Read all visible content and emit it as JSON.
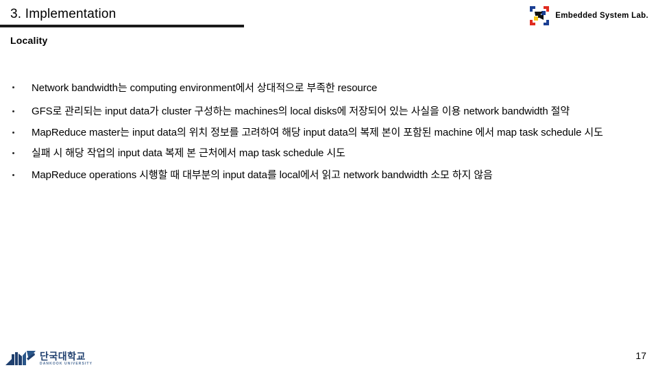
{
  "header": {
    "title": "3. Implementation",
    "lab": {
      "name": "Embedded System Lab.",
      "logo_icon": "puzzle-pinwheel-logo-icon",
      "colors": {
        "blue": "#1b3f93",
        "red": "#e02b20",
        "yellow": "#f5c518",
        "black": "#111111"
      }
    }
  },
  "section": {
    "heading": "Locality"
  },
  "bullets": [
    {
      "text": "Network bandwidth는 computing environment에서 상대적으로 부족한 resource"
    },
    {
      "text": "GFS로  관리되는 input data가 cluster 구성하는 machines의 local disks에 저장되어 있는 사실을 이용 network bandwidth 절약"
    },
    {
      "text": "MapReduce master는 input data의 위치 정보를 고려하여 해당 input data의 복제 본이 포함된 machine 에서 map task schedule 시도"
    },
    {
      "text": "실패 시 해당 작업의 input data 복제 본 근처에서 map task schedule 시도"
    },
    {
      "text": "MapReduce operations 시행할 때 대부분의 input data를 local에서 읽고 network bandwidth 소모 하지 않음"
    }
  ],
  "footer": {
    "university": {
      "name_ko": "단국대학교",
      "name_en": "DANKOOK UNIVERSITY",
      "logo_icon": "dankook-university-logo-icon",
      "color": "#1f3f6e"
    },
    "page_number": "17"
  }
}
